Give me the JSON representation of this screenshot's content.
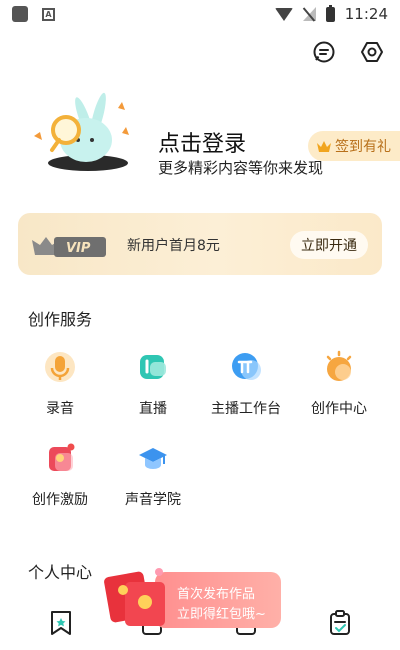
{
  "status_bar": {
    "time": "11:24"
  },
  "profile": {
    "login_title": "点击登录",
    "login_subtitle": "更多精彩内容等你来发现",
    "checkin_label": "签到有礼"
  },
  "vip": {
    "badge_text": "VIP",
    "offer_text": "新用户首月8元",
    "button_label": "立即开通"
  },
  "creation": {
    "title": "创作服务",
    "items": [
      {
        "label": "录音",
        "icon": "microphone-icon"
      },
      {
        "label": "直播",
        "icon": "live-icon"
      },
      {
        "label": "主播工作台",
        "icon": "workbench-icon"
      },
      {
        "label": "创作中心",
        "icon": "creation-center-icon"
      },
      {
        "label": "创作激励",
        "icon": "incentive-icon"
      },
      {
        "label": "声音学院",
        "icon": "academy-icon"
      }
    ]
  },
  "personal": {
    "title": "个人中心"
  },
  "promo": {
    "line1": "首次发布作品",
    "line2": "立即得红包哦~"
  },
  "colors": {
    "accent_gold": "#b8701a",
    "vip_bg": "#f8e7c7",
    "promo_red": "#ff8f8f",
    "teal": "#2fc6b3"
  }
}
